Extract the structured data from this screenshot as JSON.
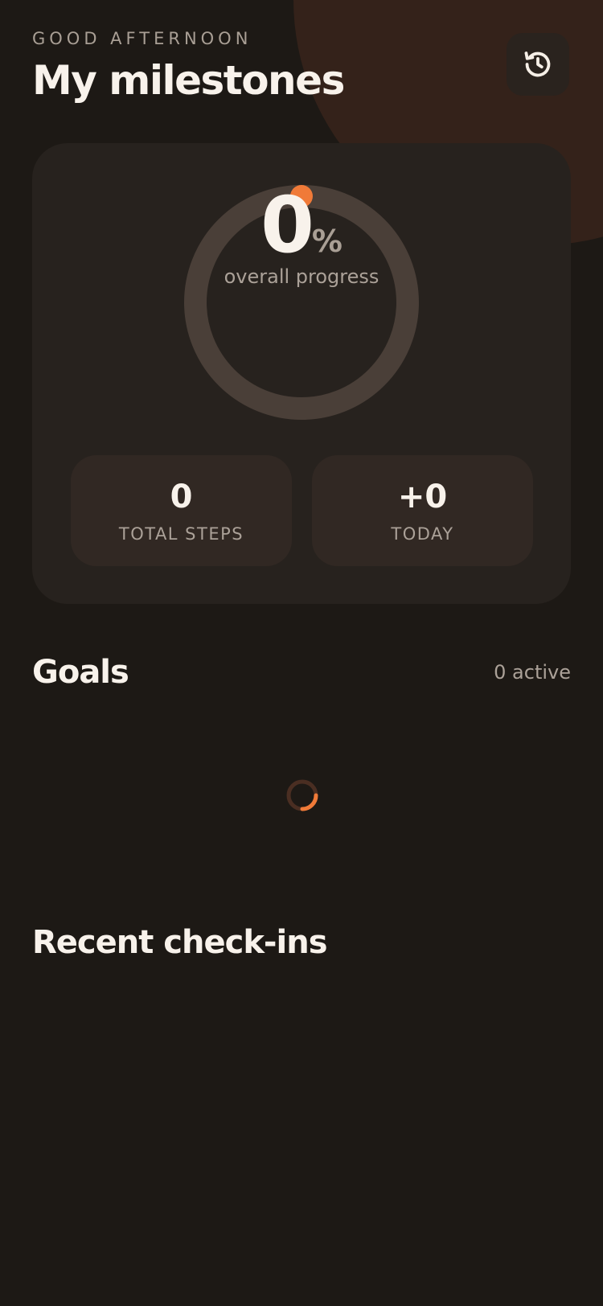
{
  "header": {
    "greeting": "GOOD AFTERNOON",
    "title": "My milestones",
    "history_icon": "history-icon"
  },
  "progress": {
    "percent": 0,
    "percent_display": "0",
    "percent_sign": "%",
    "label": "overall progress"
  },
  "stats": [
    {
      "value": "0",
      "label": "TOTAL STEPS"
    },
    {
      "value": "+0",
      "label": "TODAY"
    }
  ],
  "goals": {
    "heading": "Goals",
    "count_label": "0 active",
    "loading_icon": "loading-spinner-icon"
  },
  "checkins": {
    "heading": "Recent check-ins"
  },
  "colors": {
    "background": "#1d1915",
    "card": "#27221e",
    "stat_card": "#312823",
    "accent": "#f07a38",
    "ring_track": "#4a3f38",
    "blob": "#34221a",
    "text_primary": "#f8f2eb",
    "text_muted": "#aba198"
  }
}
